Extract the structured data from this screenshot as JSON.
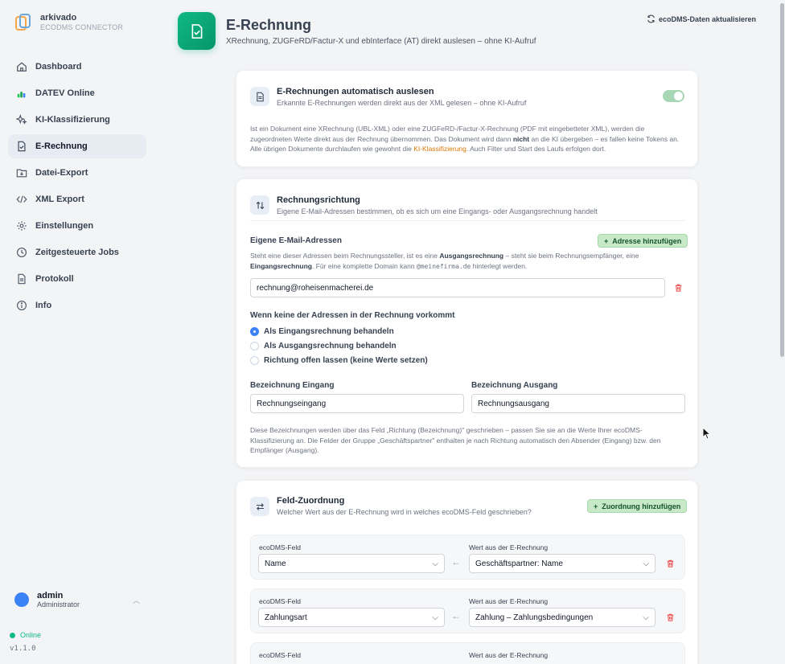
{
  "brand": {
    "name": "arkivado",
    "sub": "ECODMS CONNECTOR"
  },
  "nav": [
    {
      "label": "Dashboard",
      "icon": "home-icon"
    },
    {
      "label": "DATEV Online",
      "icon": "datev-icon"
    },
    {
      "label": "KI-Klassifizierung",
      "icon": "sparkle-icon"
    },
    {
      "label": "E-Rechnung",
      "icon": "file-check-icon"
    },
    {
      "label": "Datei-Export",
      "icon": "folder-export-icon"
    },
    {
      "label": "XML Export",
      "icon": "code-icon"
    },
    {
      "label": "Einstellungen",
      "icon": "gear-icon"
    },
    {
      "label": "Zeitgesteuerte Jobs",
      "icon": "clock-icon"
    },
    {
      "label": "Protokoll",
      "icon": "log-icon"
    },
    {
      "label": "Info",
      "icon": "info-icon"
    }
  ],
  "active_nav": "E-Rechnung",
  "user": {
    "name": "admin",
    "role": "Administrator"
  },
  "status": "Online",
  "version": "v1.1.0",
  "header": {
    "title": "E-Rechnung",
    "subtitle": "XRechnung, ZUGFeRD/Factur-X und ebInterface (AT) direkt auslesen – ohne KI-Aufruf",
    "refresh_label": "ecoDMS-Daten aktualisieren"
  },
  "auto_card": {
    "title": "E-Rechnungen automatisch auslesen",
    "subtitle": "Erkannte E-Rechnungen werden direkt aus der XML gelesen – ohne KI-Aufruf",
    "enabled": true,
    "help_1": "Ist ein Dokument eine XRechnung (UBL-XML) oder eine ZUGFeRD-/Factur-X-Rechnung (PDF mit eingebetteter XML), werden die zugeordneten Werte direkt aus der Rechnung übernommen. Das Dokument wird dann ",
    "help_bold": "nicht",
    "help_2": " an die KI übergeben – es fallen keine Tokens an. Alle übrigen Dokumente durchlaufen wie gewohnt die ",
    "help_link": "KI-Klassifizierung",
    "help_3": ". Auch Filter und Start des Laufs erfolgen dort."
  },
  "direction_card": {
    "title": "Rechnungsrichtung",
    "subtitle": "Eigene E-Mail-Adressen bestimmen, ob es sich um eine Eingangs- oder Ausgangsrechnung handelt",
    "emails_label": "Eigene E-Mail-Adressen",
    "add_address_label": "Adresse hinzufügen",
    "emails_help_1": "Steht eine dieser Adressen beim Rechnungssteller, ist es eine ",
    "emails_help_b1": "Ausgangsrechnung",
    "emails_help_2": " – steht sie beim Rechnungsempfänger, eine ",
    "emails_help_b2": "Eingangsrechnung",
    "emails_help_3": ". Für eine komplette Domain kann ",
    "emails_help_code": "@meinefirma.de",
    "emails_help_4": " hinterlegt werden.",
    "email_value": "rechnung@roheisenmacherei.de",
    "fallback_label": "Wenn keine der Adressen in der Rechnung vorkommt",
    "options": [
      {
        "label": "Als Eingangsrechnung behandeln",
        "selected": true
      },
      {
        "label": "Als Ausgangsrechnung behandeln",
        "selected": false
      },
      {
        "label": "Richtung offen lassen (keine Werte setzen)",
        "selected": false
      }
    ],
    "in_label": "Bezeichnung Eingang",
    "in_value": "Rechnungseingang",
    "out_label": "Bezeichnung Ausgang",
    "out_value": "Rechnungsausgang",
    "footer_help": "Diese Bezeichnungen werden über das Feld „Richtung (Bezeichnung)\" geschrieben – passen Sie sie an die Werte Ihrer ecoDMS-Klassifizierung an. Die Felder der Gruppe „Geschäftspartner\" enthalten je nach Richtung automatisch den Absender (Eingang) bzw. den Empfänger (Ausgang)."
  },
  "mapping_card": {
    "title": "Feld-Zuordnung",
    "subtitle": "Welcher Wert aus der E-Rechnung wird in welches ecoDMS-Feld geschrieben?",
    "add_label": "Zuordnung hinzufügen",
    "field_label": "ecoDMS-Feld",
    "value_label": "Wert aus der E-Rechnung",
    "rows": [
      {
        "field": "Name",
        "value": "Geschäftspartner: Name"
      },
      {
        "field": "Zahlungsart",
        "value": "Zahlung – Zahlungsbedingungen"
      },
      {
        "field": "",
        "value": ""
      }
    ]
  },
  "colors": {
    "accent": "#10b981",
    "danger": "#ef4444",
    "link": "#d97706",
    "primary": "#3b82f6"
  }
}
